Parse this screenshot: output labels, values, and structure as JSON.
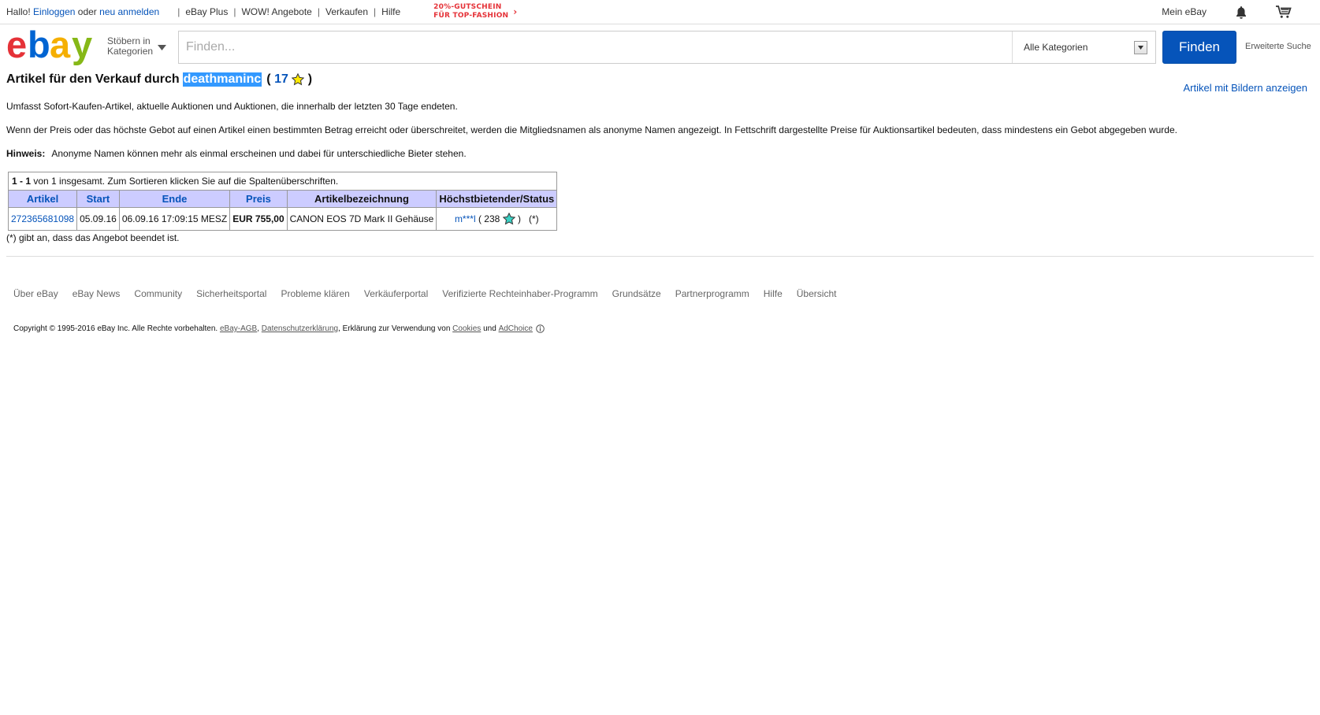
{
  "topbar": {
    "greeting": "Hallo!",
    "login": "Einloggen",
    "or": "oder",
    "register": "neu anmelden",
    "nav": [
      "eBay Plus",
      "WOW! Angebote",
      "Verkaufen",
      "Hilfe"
    ],
    "promo_line1": "20%-GUTSCHEIN",
    "promo_line2": "FÜR TOP-FASHION",
    "my_ebay": "Mein eBay"
  },
  "header": {
    "logo_colors": [
      "#e53238",
      "#0064d2",
      "#f5af02",
      "#86b817"
    ],
    "browse_line1": "Stöbern in",
    "browse_line2": "Kategorien",
    "search_placeholder": "Finden...",
    "category": "Alle Kategorien",
    "search_button": "Finden",
    "advanced": "Erweiterte Suche"
  },
  "main": {
    "title_prefix": "Artikel für den Verkauf durch",
    "seller": "deathmaninc",
    "feedback_open": "(",
    "feedback_count": "17",
    "feedback_close": ")",
    "show_pictures": "Artikel mit Bildern anzeigen",
    "para1": "Umfasst Sofort-Kaufen-Artikel, aktuelle Auktionen und Auktionen, die innerhalb der letzten 30 Tage endeten.",
    "para2": "Wenn der Preis oder das höchste Gebot auf einen Artikel einen bestimmten Betrag erreicht oder überschreitet, werden die Mitgliedsnamen als anonyme Namen angezeigt. In Fettschrift dargestellte Preise für Auktionsartikel bedeuten, dass mindestens ein Gebot abgegeben wurde.",
    "hint_label": "Hinweis:",
    "hint_text": "Anonyme Namen können mehr als einmal erscheinen und dabei für unterschiedliche Bieter stehen."
  },
  "table": {
    "summary_range": "1 - 1",
    "summary_text": "von 1 insgesamt. Zum Sortieren klicken Sie auf die Spaltenüberschriften.",
    "headers": [
      "Artikel",
      "Start",
      "Ende",
      "Preis",
      "Artikelbezeichnung",
      "Höchstbietender/Status"
    ],
    "rows": [
      {
        "item": "272365681098",
        "start": "05.09.16",
        "end": "06.09.16 17:09:15 MESZ",
        "price": "EUR 755,00",
        "title": "CANON EOS 7D Mark II Gehäuse",
        "bidder": "m***l",
        "bidder_open": "(",
        "bidder_score": "238",
        "bidder_close": ")",
        "status": "(*)"
      }
    ],
    "footnote": "(*) gibt an, dass das Angebot beendet ist."
  },
  "footer": {
    "links": [
      "Über eBay",
      "eBay News",
      "Community",
      "Sicherheitsportal",
      "Probleme klären",
      "Verkäuferportal",
      "Verifizierte Rechteinhaber-Programm",
      "Grundsätze",
      "Partnerprogramm",
      "Hilfe",
      "Übersicht"
    ],
    "copyright": "Copyright © 1995-2016 eBay Inc. Alle Rechte vorbehalten.",
    "agb": "eBay-AGB",
    "privacy": "Datenschutzerklärung",
    "cookies_text": ", Erklärung zur Verwendung von",
    "cookies": "Cookies",
    "and": "und",
    "adchoice": "AdChoice"
  }
}
